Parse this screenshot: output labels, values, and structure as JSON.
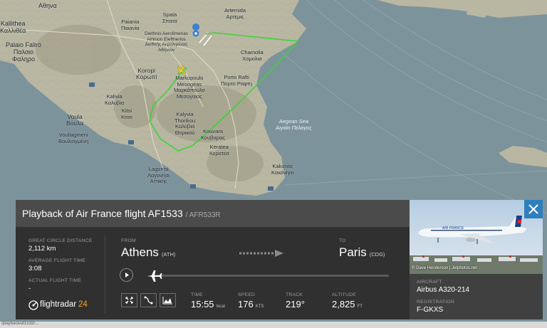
{
  "map": {
    "labels": {
      "athens": "Αθηνα",
      "kallithea": "Kallithea\nΚαλλιθέα",
      "palaio_faliro": "Palaio Faliro\nΠαλαιο\nΦαληρο",
      "paiania": "Paiania\nΠαιανία",
      "spata": "Spata\nΣπατα",
      "artemida": "Artemida\nΑρτεμις",
      "airport": "Diethnis Aerolimenas\nAthinon Eleftherios\nΔιεθνής Αερολιμένας\nΑθηνών",
      "koropi": "Koropi\nΚορωπί",
      "chamolia": "Chamolia\nΧαμολια",
      "markopoulo": "Markopoulo\nMesogeas\nΜαρκόπουλο\nΜεσογαίας",
      "porto_rafti": "Porto Rafti\nΠορτο Ραφτη",
      "kalivia_pk": "Kalivia\nΚαλυβια",
      "kitsi": "Kitsi\nΚιτσι",
      "vari": "Voula\nΒουλα",
      "vouliagmeni": "Vouliagmeni\nΒουλιαγμένη",
      "kalyvia": "Kalyvia\nThorikou\nΚαλύβια\nΘορικού",
      "kouvaras": "Kouvara\nΚουβαρας",
      "aegean": "Aegean Sea\nΑιγαίο Πέλαγος",
      "keratea": "Keratea\nΚερατεα",
      "lagonisi": "Lagonisi\nΛαγονήσι\nΑττικής",
      "kakonisi": "Kakonisi\nΚακόνησι"
    },
    "route_color": "#3fd13a"
  },
  "flight": {
    "title": "Playback of Air France flight AF1533",
    "callsign": "/ AFR533R",
    "great_circle_label": "GREAT CIRCLE DISTANCE",
    "great_circle_value": "2,112 km",
    "avg_time_label": "AVERAGE FLIGHT TIME",
    "avg_time_value": "3:08",
    "actual_time_label": "ACTUAL FLIGHT TIME",
    "actual_time_value": "-",
    "from_label": "FROM",
    "from_city": "Athens",
    "from_code": "(ATH)",
    "to_label": "TO",
    "to_city": "Paris",
    "to_code": "(CDG)",
    "playback_progress": 0.0,
    "time_label": "TIME",
    "time_value": "15:55",
    "time_unit": "local",
    "speed_label": "SPEED",
    "speed_value": "176",
    "speed_unit": "KTS",
    "track_label": "TRACK",
    "track_value": "219°",
    "altitude_label": "ALTITUDE",
    "altitude_value": "2,825",
    "altitude_unit": "FT"
  },
  "brand": {
    "name": "flightradar",
    "suffix": "24"
  },
  "photo": {
    "credit": "© Dave Henderson | Jetphotos.net"
  },
  "aircraft": {
    "aircraft_label": "AIRCRAFT",
    "aircraft_value": "Airbus A320-214",
    "registration_label": "REGISTRATION",
    "registration_value": "F-GKXS"
  },
  "statusbar": {
    "url": "/playback/af1533/..."
  },
  "icons": {
    "close": "close-icon",
    "play": "play-icon",
    "plane": "plane-icon",
    "fit": "fit-view-icon",
    "route": "route-icon",
    "chart": "altitude-chart-icon",
    "airport": "airport-pin-icon"
  },
  "colors": {
    "panel_bg": "#303030",
    "header_bg": "#4b4b4b",
    "accent_blue": "#2e7fbd",
    "brand_orange": "#f5a623"
  }
}
